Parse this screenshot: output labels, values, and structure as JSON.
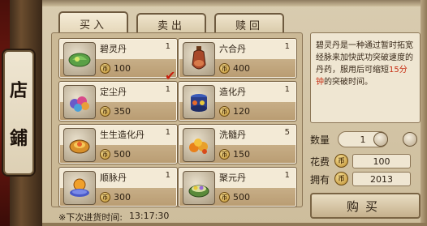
{
  "shop_sign": [
    "店",
    "鋪"
  ],
  "tabs": [
    {
      "label": "买入",
      "active": true
    },
    {
      "label": "卖出",
      "active": false
    },
    {
      "label": "赎回",
      "active": false
    }
  ],
  "items": [
    {
      "name": "碧灵丹",
      "qty": "1",
      "price": "100",
      "icon": "green-leaf-pill-icon",
      "selected": true
    },
    {
      "name": "六合丹",
      "qty": "1",
      "price": "400",
      "icon": "gourd-bottle-icon",
      "selected": false
    },
    {
      "name": "定尘丹",
      "qty": "1",
      "price": "350",
      "icon": "multicolor-pills-icon",
      "selected": false
    },
    {
      "name": "造化丹",
      "qty": "1",
      "price": "120",
      "icon": "pill-jar-icon",
      "selected": false
    },
    {
      "name": "生生造化丹",
      "qty": "1",
      "price": "500",
      "icon": "orange-ring-pill-icon",
      "selected": false
    },
    {
      "name": "洗髓丹",
      "qty": "5",
      "price": "150",
      "icon": "pill-pile-icon",
      "selected": false
    },
    {
      "name": "顺脉丹",
      "qty": "1",
      "price": "300",
      "icon": "orange-orb-bowl-icon",
      "selected": false
    },
    {
      "name": "聚元丹",
      "qty": "1",
      "price": "500",
      "icon": "jade-bowl-icon",
      "selected": false
    }
  ],
  "coin_glyph": "币",
  "restock": {
    "label": "※下次进货时间:",
    "time": "13:17:30"
  },
  "description": {
    "pre": "碧灵丹是一种通过暂时拓宽经脉来加快武功突破速度的丹药，服用后可缩短",
    "highlight": "15分钟",
    "post": "的突破时间。"
  },
  "purchase": {
    "quantity_label": "数量",
    "quantity_value": "1",
    "cost_label": "花费",
    "cost_value": "100",
    "owned_label": "拥有",
    "owned_value": "2013",
    "buy_label": "购买"
  },
  "colors": {
    "highlight": "#c62d12",
    "check": "#c81e0e",
    "panel": "#efe6d2"
  }
}
